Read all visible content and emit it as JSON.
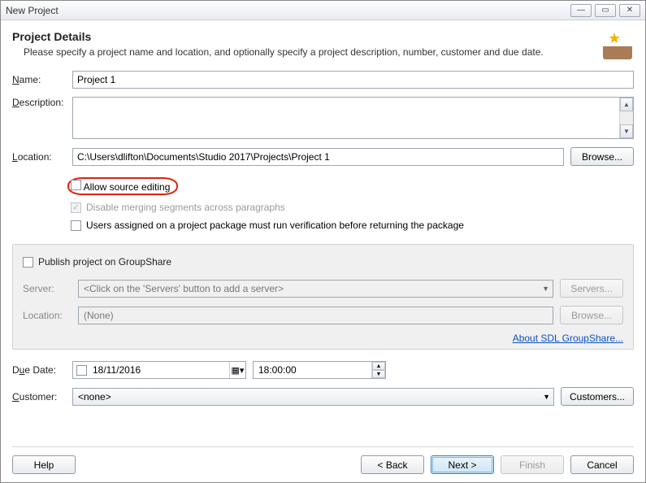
{
  "window": {
    "title": "New Project"
  },
  "header": {
    "title": "Project Details",
    "subtitle": "Please specify a project name and location, and optionally specify a project description, number, customer and due date."
  },
  "labels": {
    "name": "Name:",
    "description": "Description:",
    "location": "Location:",
    "browse": "Browse...",
    "allow_source": "Allow source editing",
    "disable_merge": "Disable merging segments across paragraphs",
    "verify_pkg": "Users assigned on a project package must run verification before returning the package",
    "publish_gs": "Publish project on GroupShare",
    "server": "Server:",
    "gs_location": "Location:",
    "servers_btn": "Servers...",
    "gs_browse": "Browse...",
    "about_link": "About SDL GroupShare...",
    "due_date": "Due Date:",
    "customer": "Customer:",
    "customers_btn": "Customers...",
    "help": "Help",
    "back": "< Back",
    "next": "Next >",
    "finish": "Finish",
    "cancel": "Cancel"
  },
  "values": {
    "name": "Project 1",
    "description": "",
    "location": "C:\\Users\\dlifton\\Documents\\Studio 2017\\Projects\\Project 1",
    "server_placeholder": "<Click on the 'Servers' button to add a server>",
    "gs_location": "(None)",
    "due_date": "18/11/2016",
    "due_time": "18:00:00",
    "customer": "<none>"
  }
}
